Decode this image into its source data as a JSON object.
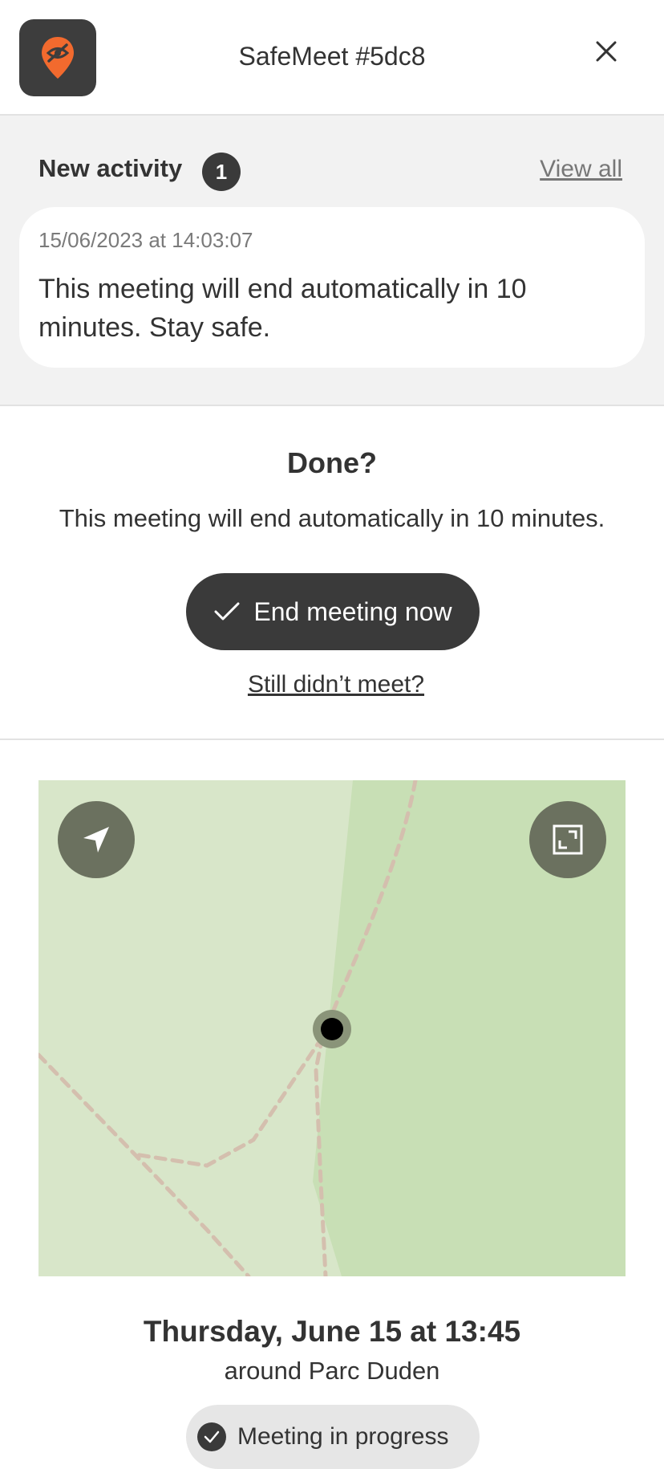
{
  "header": {
    "title": "SafeMeet #5dc8",
    "logo_icon": "hidden-location-pin-icon",
    "close_icon": "close-icon",
    "accent_color": "#f26a2e"
  },
  "activity": {
    "heading": "New activity",
    "count": "1",
    "view_all_label": "View all",
    "items": [
      {
        "timestamp": "15/06/2023 at 14:03:07",
        "message": "This meeting will end automatically in 10 minutes. Stay safe."
      }
    ]
  },
  "done_section": {
    "title": "Done?",
    "text": "This meeting will end automatically in 10 minutes.",
    "end_button_label": "End meeting now",
    "end_button_icon": "check-icon",
    "still_link_label": "Still didn’t meet?"
  },
  "map": {
    "locate_icon": "navigation-arrow-icon",
    "expand_icon": "expand-icon",
    "marker": "location-marker",
    "colors": {
      "land": "#d8e6c9",
      "park": "#c8dfb5",
      "path": "#d4bfae"
    }
  },
  "meeting": {
    "date_time": "Thursday, June 15 at 13:45",
    "location": "around Parc Duden",
    "status_label": "Meeting in progress",
    "status_icon": "check-circle-icon"
  }
}
